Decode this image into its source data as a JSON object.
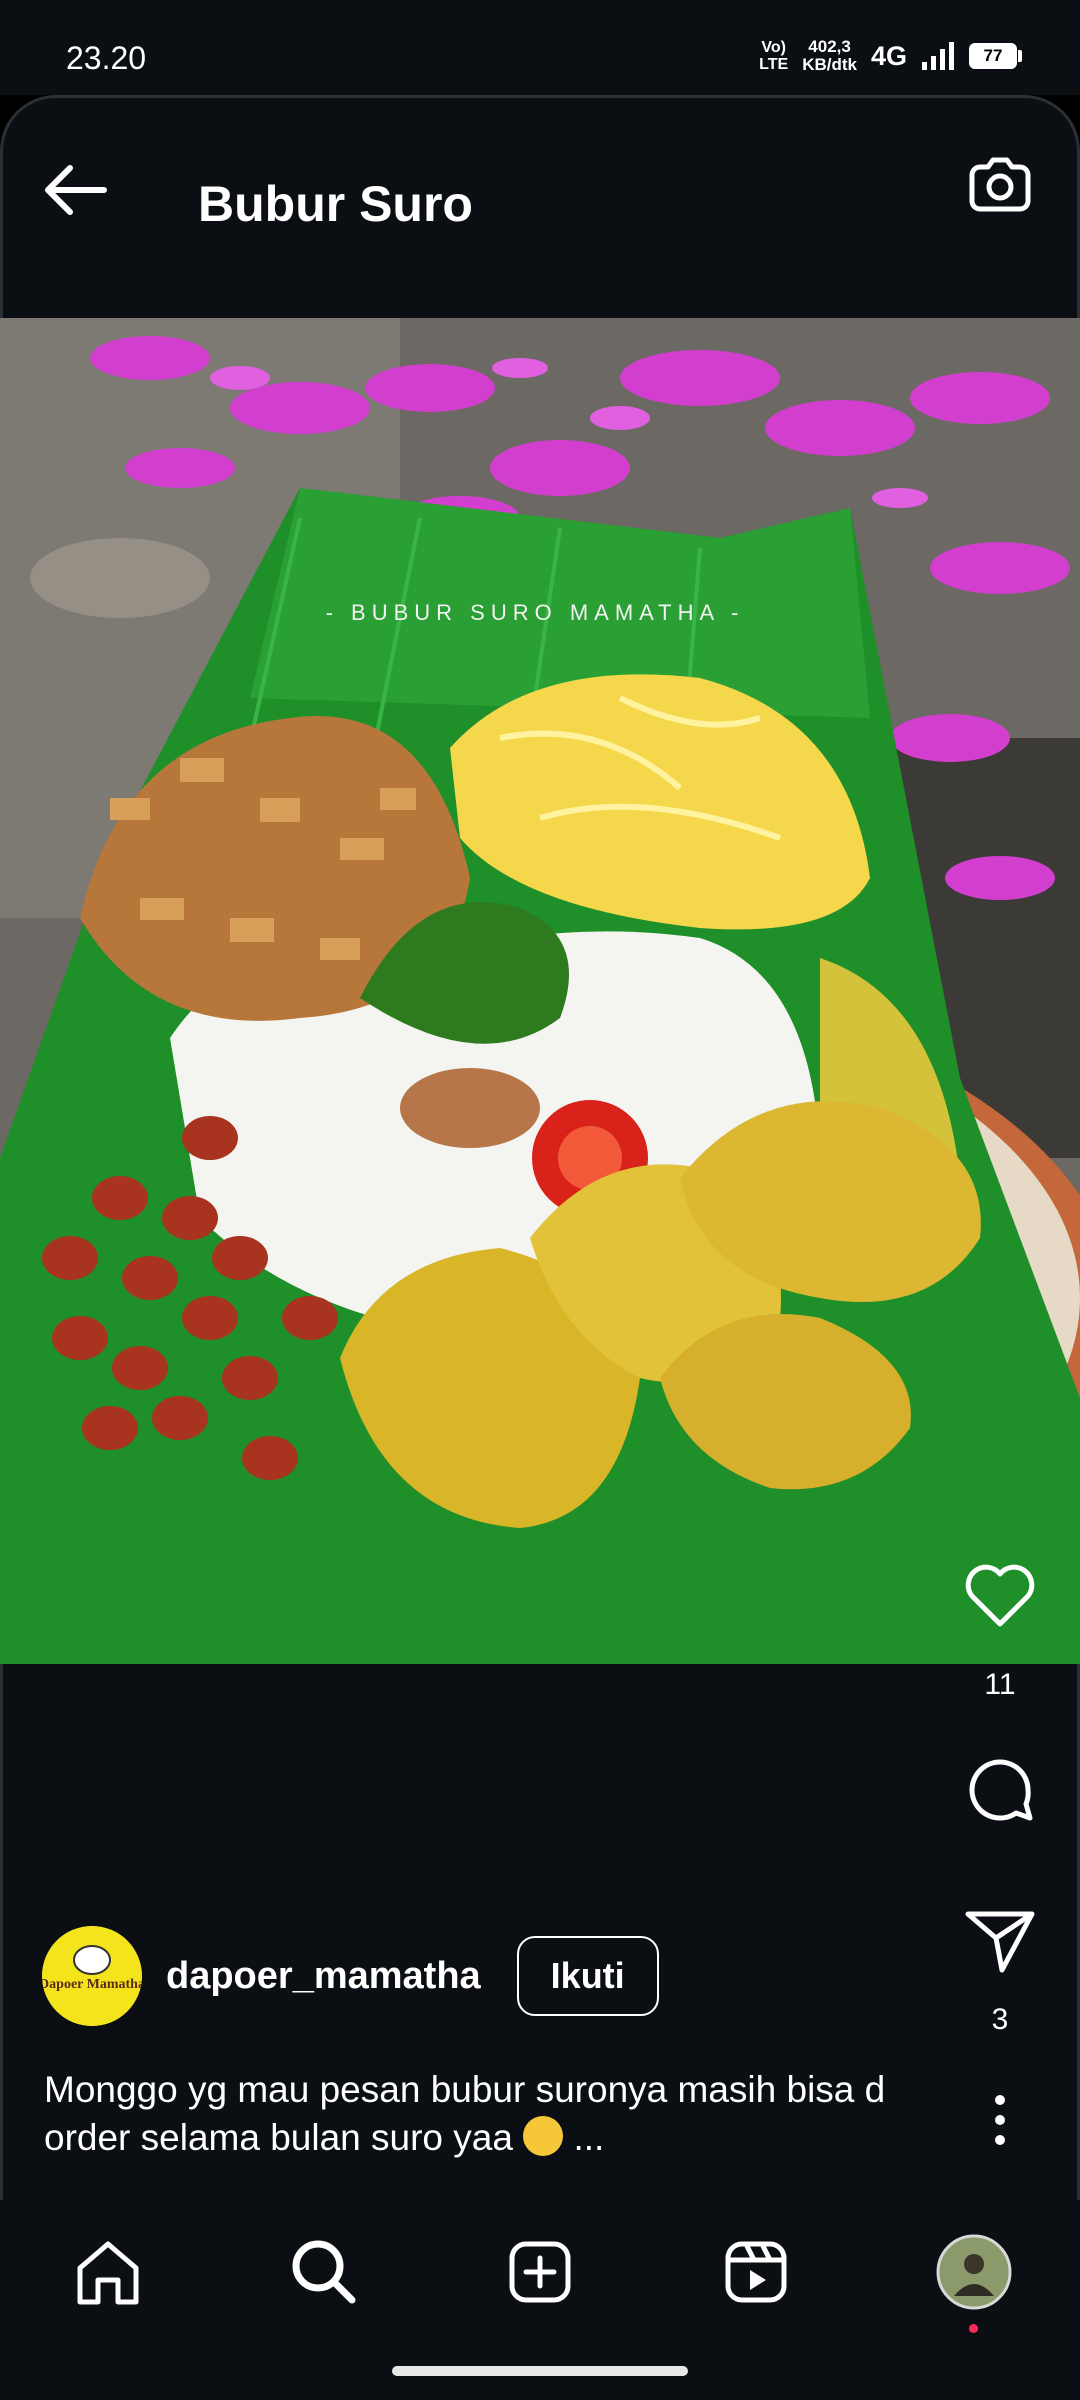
{
  "status": {
    "time": "23.20",
    "network_type": "Vo) LTE",
    "speed_value": "402,3",
    "speed_unit": "KB/dtk",
    "signal": "4G",
    "battery": "77"
  },
  "header": {
    "title": "Bubur Suro"
  },
  "post": {
    "image_caption_overlay": "- BUBUR SURO MAMATHA -",
    "likes": "11",
    "shares": "3",
    "author": "dapoer_mamatha",
    "avatar_text": "Dapoer Mamatha",
    "follow_label": "Ikuti",
    "caption": "Monggo yg mau pesan bubur suronya  masih bisa d order selama bulan suro yaa",
    "caption_more": "..."
  },
  "icons": {
    "back": "arrow-left-icon",
    "camera": "camera-icon",
    "like": "heart-icon",
    "comment": "comment-icon",
    "share": "send-icon",
    "more": "more-vertical-icon",
    "home": "home-icon",
    "search": "search-icon",
    "create": "plus-square-icon",
    "reels": "reels-icon",
    "profile": "profile-avatar"
  },
  "colors": {
    "background": "#0b0e13",
    "accent_dot": "#ff2d55"
  }
}
